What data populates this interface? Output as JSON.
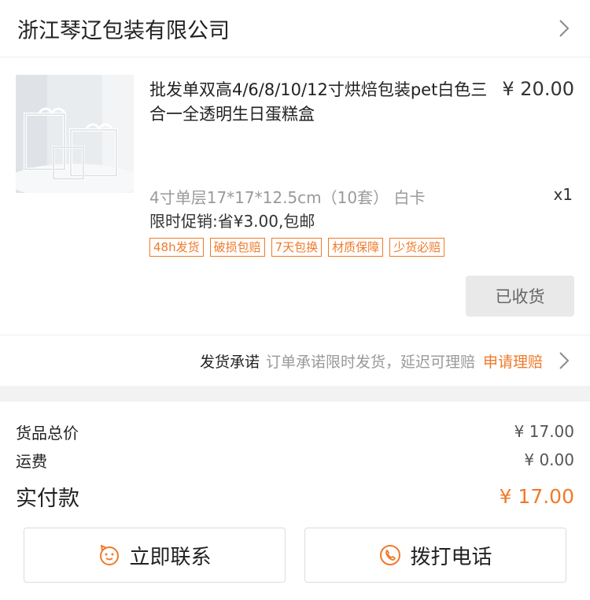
{
  "shop": {
    "name": "浙江琴辽包装有限公司"
  },
  "product": {
    "title": "批发单双高4/6/8/10/12寸烘焙包装pet白色三合一全透明生日蛋糕盒",
    "price": "¥ 20.00",
    "spec": "4寸单层17*17*12.5cm（10套） 白卡",
    "qty": "x1",
    "promo": "限时促销:省¥3.00,包邮",
    "tags": [
      "48h发货",
      "破损包赔",
      "7天包换",
      "材质保障",
      "少货必赔"
    ]
  },
  "order_status_button": "已收货",
  "promise": {
    "label": "发货承诺",
    "desc": "订单承诺限时发货，延迟可理赔",
    "link": "申请理赔"
  },
  "summary": {
    "goods_label": "货品总价",
    "goods_value": "¥ 17.00",
    "shipping_label": "运费",
    "shipping_value": "¥ 0.00",
    "paid_label": "实付款",
    "paid_value": "¥ 17.00"
  },
  "actions": {
    "contact": "立即联系",
    "call": "拨打电话"
  },
  "colors": {
    "accent": "#f07a2a"
  },
  "icons": [
    "chevron-right-icon",
    "chat-face-icon",
    "phone-icon"
  ]
}
